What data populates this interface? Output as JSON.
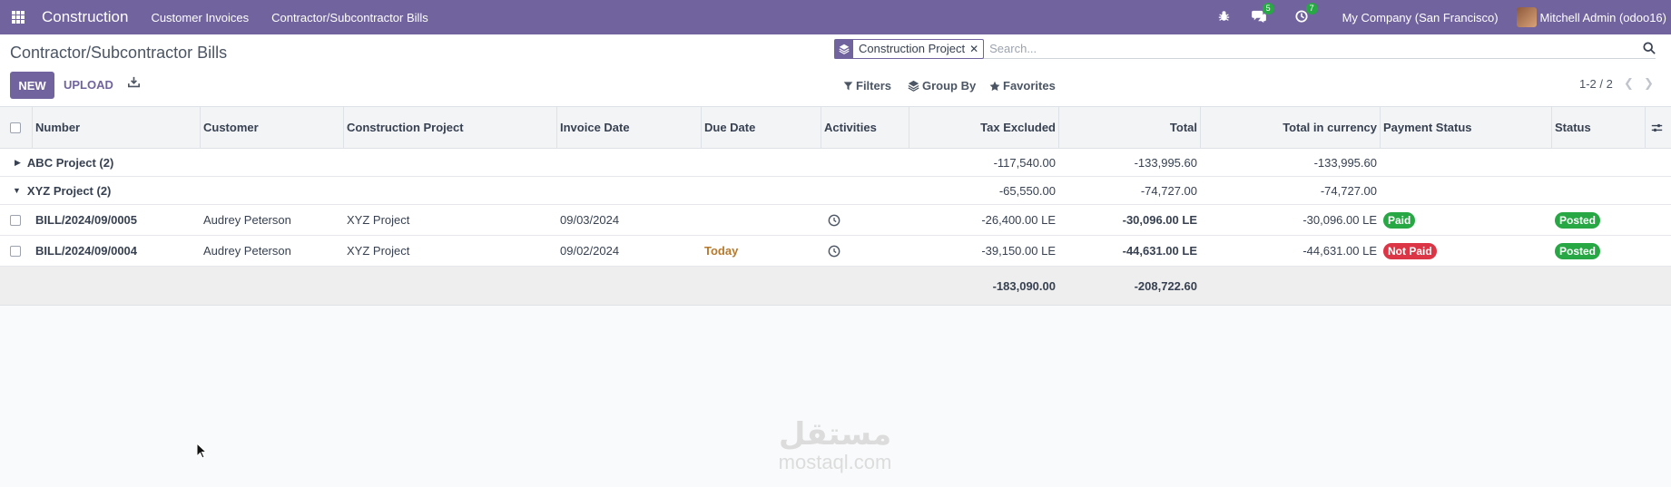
{
  "navbar": {
    "app_name": "Construction",
    "menus": [
      "Customer Invoices",
      "Contractor/Subcontractor Bills"
    ],
    "messages_count": "5",
    "activities_count": "7",
    "company": "My Company (San Francisco)",
    "user": "Mitchell Admin (odoo16)",
    "icons": [
      "apps-grid-icon",
      "bug-icon",
      "chat-icon",
      "clock-icon"
    ]
  },
  "control": {
    "title": "Contractor/Subcontractor Bills",
    "new_label": "NEW",
    "upload_label": "UPLOAD",
    "search": {
      "facet_value": "Construction Project",
      "placeholder": "Search..."
    },
    "filters_label": "Filters",
    "groupby_label": "Group By",
    "favorites_label": "Favorites",
    "pager": "1-2 / 2"
  },
  "table": {
    "headers": [
      "Number",
      "Customer",
      "Construction Project",
      "Invoice Date",
      "Due Date",
      "Activities",
      "Tax Excluded",
      "Total",
      "Total in currency",
      "Payment Status",
      "Status"
    ],
    "groups": [
      {
        "label": "ABC Project (2)",
        "expanded": false,
        "tax_excluded": "-117,540.00",
        "total": "-133,995.60",
        "total_currency": "-133,995.60"
      },
      {
        "label": "XYZ Project (2)",
        "expanded": true,
        "tax_excluded": "-65,550.00",
        "total": "-74,727.00",
        "total_currency": "-74,727.00"
      }
    ],
    "records": [
      {
        "number": "BILL/2024/09/0005",
        "customer": "Audrey Peterson",
        "project": "XYZ Project",
        "invoice_date": "09/03/2024",
        "due_date": "",
        "tax_excluded": "-26,400.00 LE",
        "total": "-30,096.00 LE",
        "total_currency": "-30,096.00 LE",
        "payment_status": "Paid",
        "status": "Posted"
      },
      {
        "number": "BILL/2024/09/0004",
        "customer": "Audrey Peterson",
        "project": "XYZ Project",
        "invoice_date": "09/02/2024",
        "due_date": "Today",
        "tax_excluded": "-39,150.00 LE",
        "total": "-44,631.00 LE",
        "total_currency": "-44,631.00 LE",
        "payment_status": "Not Paid",
        "status": "Posted"
      }
    ],
    "footer": {
      "tax_excluded": "-183,090.00",
      "total": "-208,722.60"
    }
  },
  "watermark": {
    "arabic": "مستقل",
    "latin": "mostaql.com"
  },
  "colors": {
    "brand": "#71639e",
    "paid": "#28a745",
    "not_paid": "#dc3545",
    "today": "#b7792c"
  }
}
